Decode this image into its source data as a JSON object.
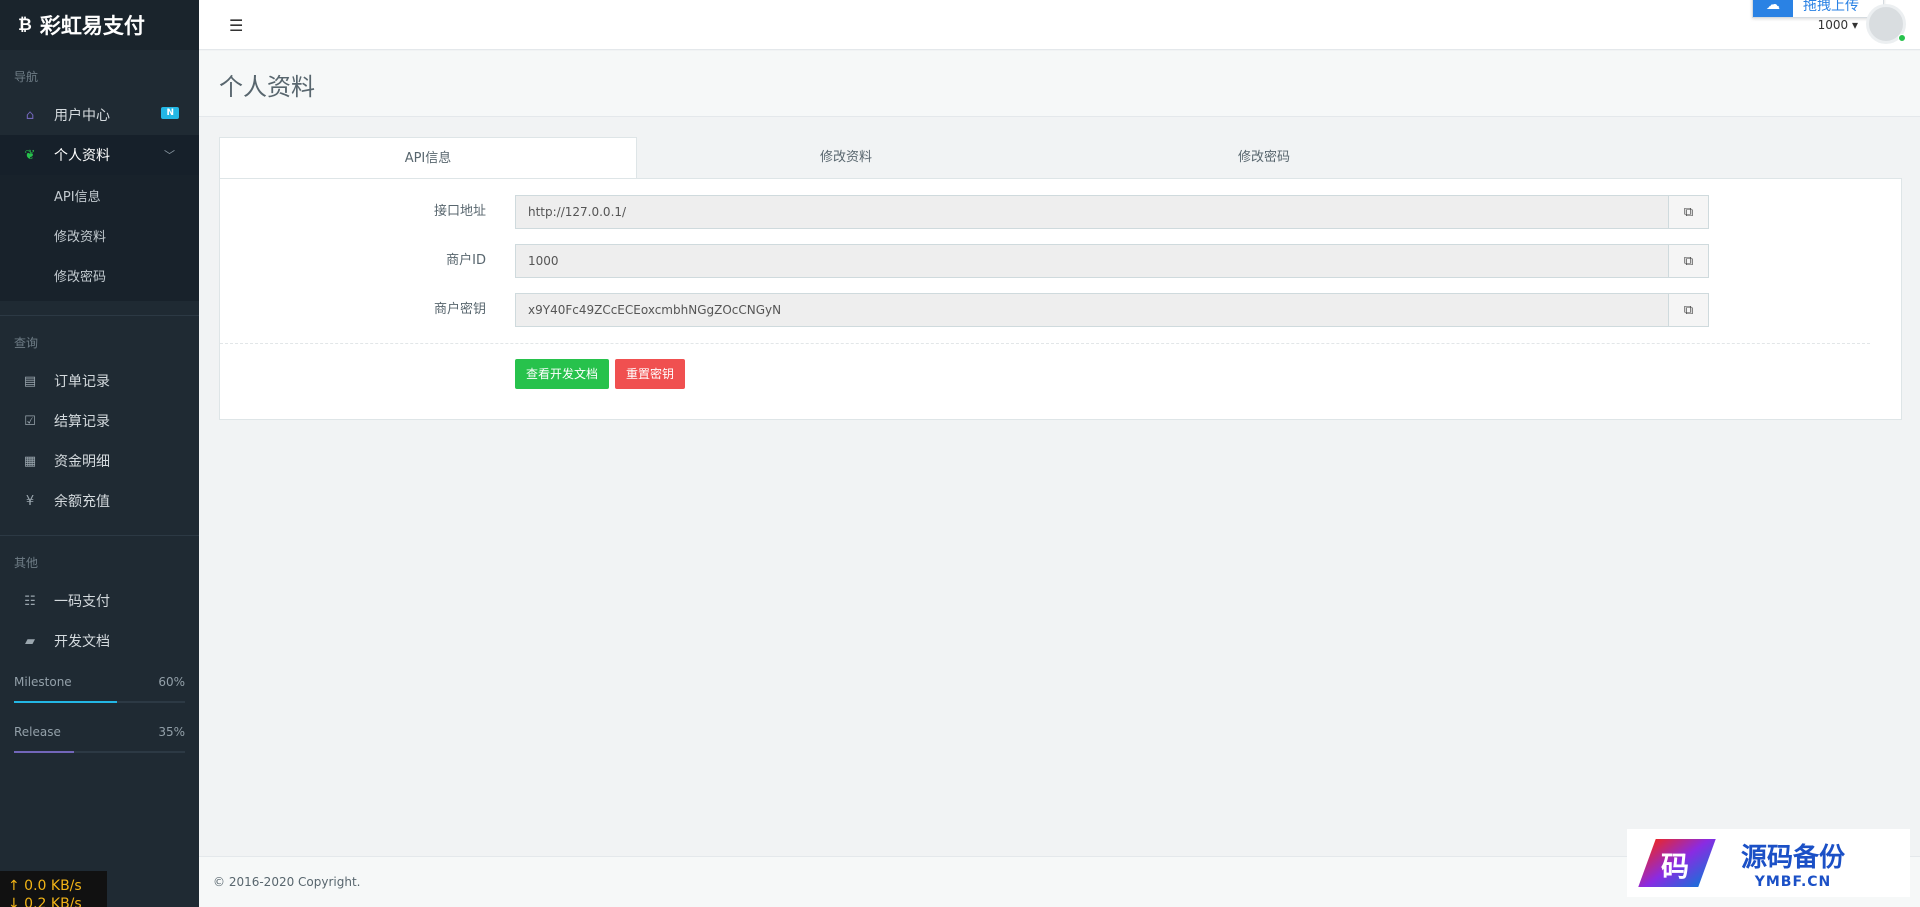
{
  "brand": {
    "icon": "bitcoin-icon",
    "glyph": "₿",
    "name": "彩虹易支付"
  },
  "sidebar": {
    "sections": {
      "nav": "导航",
      "query": "查询",
      "other": "其他"
    },
    "items": {
      "user_center": {
        "label": "用户中心",
        "badge": "N",
        "icon": "home-icon"
      },
      "profile": {
        "label": "个人资料",
        "icon": "leaf-icon"
      },
      "orders": {
        "label": "订单记录",
        "icon": "list-icon"
      },
      "settlements": {
        "label": "结算记录",
        "icon": "check-square-icon"
      },
      "funds": {
        "label": "资金明细",
        "icon": "calendar-icon"
      },
      "recharge": {
        "label": "余额充值",
        "icon": "yen-icon"
      },
      "onecode": {
        "label": "一码支付",
        "icon": "qr-list-icon"
      },
      "docs": {
        "label": "开发文档",
        "icon": "book-icon"
      }
    },
    "profile_sub": [
      "API信息",
      "修改资料",
      "修改密码"
    ],
    "progress": [
      {
        "label": "Milestone",
        "value": "60%",
        "fraction": 0.6
      },
      {
        "label": "Release",
        "value": "35%",
        "fraction": 0.35
      }
    ]
  },
  "netspeed": {
    "up": "↑ 0.0 KB/s",
    "down": "↓ 0.2 KB/s"
  },
  "header": {
    "user_id": "1000 ▾",
    "upload_popup": "拖拽上传"
  },
  "page": {
    "title": "个人资料"
  },
  "tabs": [
    "API信息",
    "修改资料",
    "修改密码"
  ],
  "form": {
    "api_url": {
      "label": "接口地址",
      "value": "http://127.0.0.1/"
    },
    "merchant_id": {
      "label": "商户ID",
      "value": "1000"
    },
    "merchant_key": {
      "label": "商户密钥",
      "value": "x9Y40Fc49ZCcECEoxcmbhNGgZOcCNGyN"
    }
  },
  "buttons": {
    "docs": "查看开发文档",
    "reset": "重置密钥"
  },
  "footer": {
    "copyright": "© 2016-2020 Copyright."
  },
  "watermark": {
    "char": "码",
    "title": "源码备份",
    "sub": "YMBF.CN"
  },
  "colors": {
    "sidebar": "#1f2a33",
    "accent_blue": "#23b7e5",
    "success": "#27c24c",
    "danger": "#f05050"
  }
}
